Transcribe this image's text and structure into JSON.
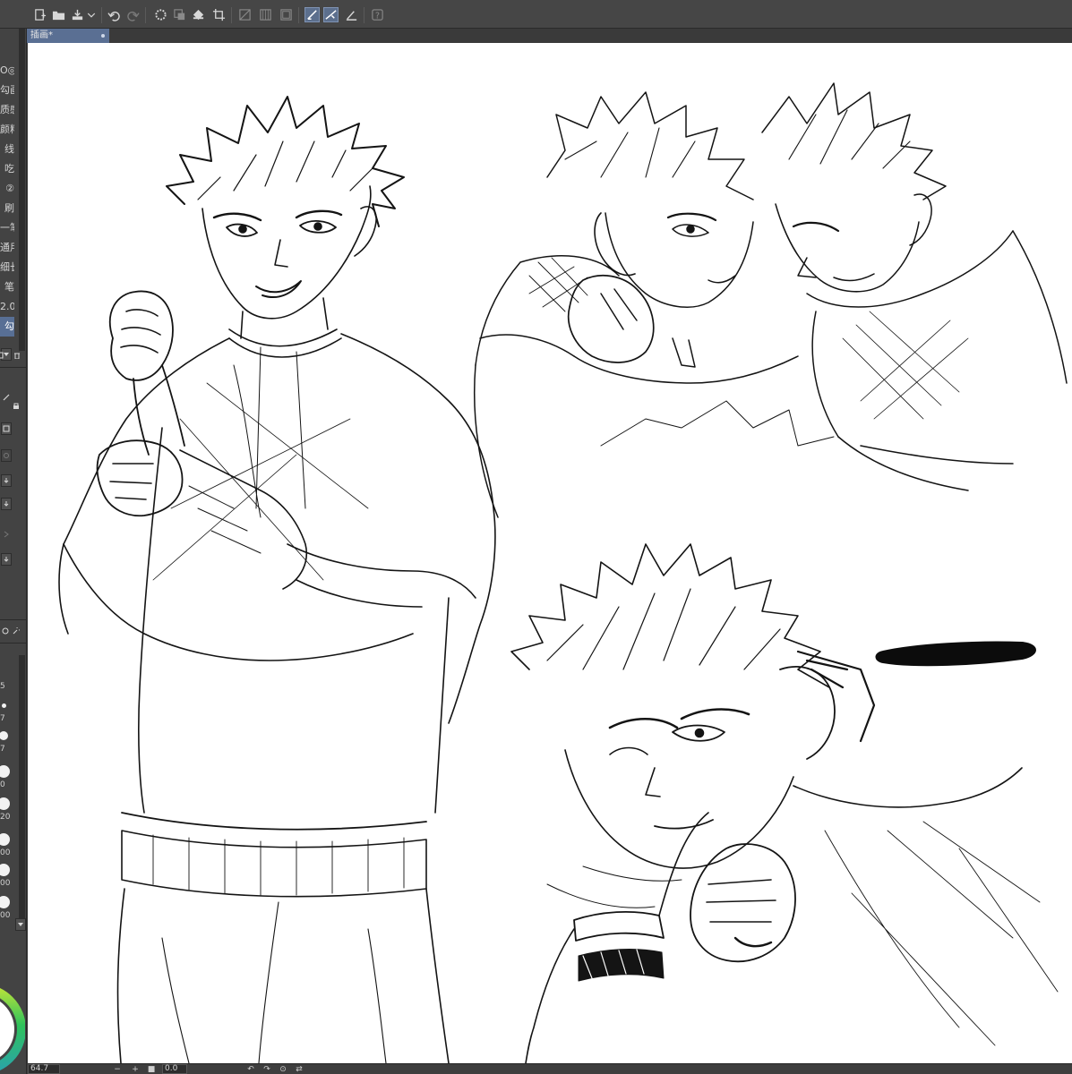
{
  "document_tab": {
    "title": "插画*"
  },
  "sub_tool_list": {
    "items": [
      {
        "label": "O◎"
      },
      {
        "label": "勾画胆"
      },
      {
        "label": "质感"
      },
      {
        "label": "颜料"
      },
      {
        "label": "线"
      },
      {
        "label": "吃"
      },
      {
        "label": "②"
      },
      {
        "label": "刷"
      },
      {
        "label": "一笔"
      },
      {
        "label": "通用"
      },
      {
        "label": "细长"
      },
      {
        "label": "笔"
      },
      {
        "label": "2.0"
      },
      {
        "label": "勾",
        "selected": true
      }
    ]
  },
  "brush_size_panel": {
    "sizes": [
      "5",
      "7",
      "7",
      "0",
      "20",
      "00",
      "00",
      "00"
    ]
  },
  "status_bar": {
    "zoom": "64.7",
    "angle": "0.0"
  },
  "accent_color": "#5a6f93",
  "toolbar_icons": [
    "new-icon",
    "open-icon",
    "save-icon",
    "dropdown-icon",
    "undo-icon",
    "redo-icon",
    "loading-icon",
    "transform-icon",
    "fill-icon",
    "crop-icon",
    "grid-icon",
    "ruler-icon",
    "frame-icon",
    "snap-ruler-icon",
    "snap-special-icon",
    "snap-grid-icon",
    "help-icon"
  ]
}
